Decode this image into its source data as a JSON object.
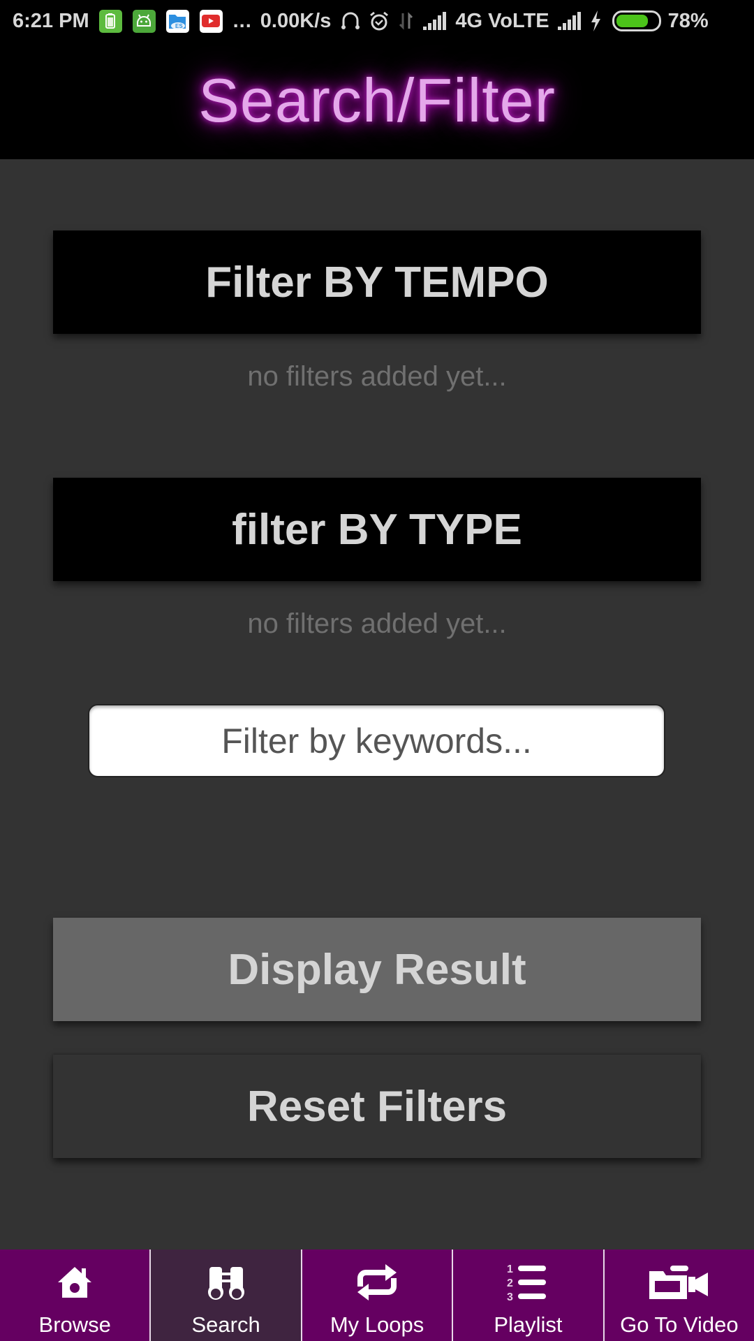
{
  "status_bar": {
    "time": "6:21 PM",
    "notification_icons": [
      "battery-saver-icon",
      "android-app-icon",
      "es-file-explorer-icon",
      "youtube-icon"
    ],
    "overflow": "...",
    "net_speed": "0.00K/s",
    "status_icons": [
      "headset-icon",
      "alarm-icon",
      "data-transfer-icon",
      "signal-icon"
    ],
    "network": "4G VoLTE",
    "battery_percent": "78%",
    "battery_level": 0.78,
    "charging": true
  },
  "header": {
    "title": "Search/Filter",
    "glow_color": "#a010a8"
  },
  "main": {
    "tempo_button": "Filter BY TEMPO",
    "tempo_hint": "no filters added yet...",
    "type_button": "filter BY TYPE",
    "type_hint": "no filters added yet...",
    "keyword_input": {
      "value": "",
      "placeholder": "Filter by keywords..."
    },
    "display_result_button": "Display Result",
    "reset_filters_button": "Reset Filters"
  },
  "bottom_nav": {
    "accent_color": "#650061",
    "active_index": 1,
    "items": [
      {
        "label": "Browse",
        "icon": "home-icon"
      },
      {
        "label": "Search",
        "icon": "binoculars-icon"
      },
      {
        "label": "My Loops",
        "icon": "repeat-icon"
      },
      {
        "label": "Playlist",
        "icon": "numbered-list-icon"
      },
      {
        "label": "Go To Video",
        "icon": "video-camera-icon"
      }
    ]
  }
}
